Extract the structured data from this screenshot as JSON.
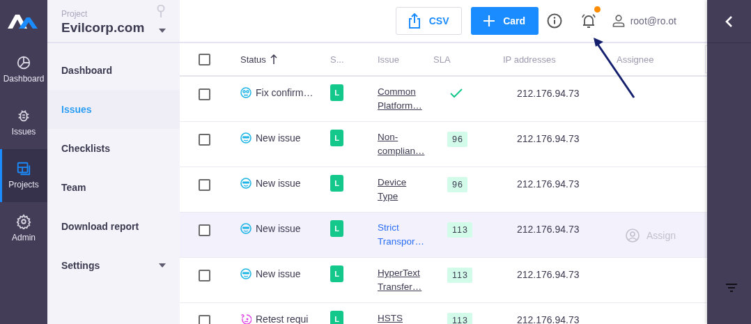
{
  "rail": {
    "items": [
      {
        "label": "Dashboard",
        "selected": false
      },
      {
        "label": "Issues",
        "selected": false
      },
      {
        "label": "Projects",
        "selected": true
      },
      {
        "label": "Admin",
        "selected": false
      }
    ]
  },
  "nav": {
    "project_label": "Project",
    "project_name": "Evilcorp.com",
    "items": [
      {
        "label": "Dashboard",
        "selected": false
      },
      {
        "label": "Issues",
        "selected": true
      },
      {
        "label": "Checklists",
        "selected": false
      },
      {
        "label": "Team",
        "selected": false
      },
      {
        "label": "Download report",
        "selected": false
      },
      {
        "label": "Settings",
        "selected": false,
        "expanded": false
      }
    ]
  },
  "toolbar": {
    "csv_button": "CSV",
    "card_button": "Card",
    "has_notifications": true,
    "user": "root@ro.ot"
  },
  "table": {
    "columns": [
      {
        "label": "Status",
        "sorted": true
      },
      {
        "label": "S...",
        "sorted": false
      },
      {
        "label": "Issue",
        "sorted": false
      },
      {
        "label": "SLA",
        "sorted": false
      },
      {
        "label": "IP addresses",
        "sorted": false
      },
      {
        "label": "Assignee",
        "sorted": false
      }
    ],
    "header_checked": false,
    "rows": [
      {
        "checked": false,
        "hovered": false,
        "status": {
          "kind": "fix_confirmed",
          "label": "Fix confirm…"
        },
        "severity": "L",
        "issue_lines": [
          "Common",
          "Platform…"
        ],
        "sla": {
          "kind": "check"
        },
        "ip": "212.176.94.73"
      },
      {
        "checked": false,
        "hovered": false,
        "status": {
          "kind": "new",
          "label": "New issue"
        },
        "severity": "L",
        "issue_lines": [
          "Non-",
          "complian…"
        ],
        "sla": {
          "kind": "badge",
          "label": "96"
        },
        "ip": "212.176.94.73"
      },
      {
        "checked": false,
        "hovered": false,
        "status": {
          "kind": "new",
          "label": "New issue"
        },
        "severity": "L",
        "issue_lines": [
          "Device",
          "Type"
        ],
        "sla": {
          "kind": "badge",
          "label": "96"
        },
        "ip": "212.176.94.73"
      },
      {
        "checked": false,
        "hovered": true,
        "status": {
          "kind": "new",
          "label": "New issue"
        },
        "severity": "L",
        "issue_lines": [
          "Strict",
          "Transpor…"
        ],
        "sla": {
          "kind": "badge",
          "label": "113"
        },
        "ip": "212.176.94.73",
        "assign": "Assign"
      },
      {
        "checked": false,
        "hovered": false,
        "status": {
          "kind": "new",
          "label": "New issue"
        },
        "severity": "L",
        "issue_lines": [
          "HyperText",
          "Transfer…"
        ],
        "sla": {
          "kind": "badge",
          "label": "113"
        },
        "ip": "212.176.94.73"
      },
      {
        "checked": false,
        "hovered": false,
        "status": {
          "kind": "retest",
          "label": "Retest requi"
        },
        "severity": "L",
        "issue_lines": [
          "HSTS"
        ],
        "sla": {
          "kind": "badge",
          "label": "113"
        },
        "ip": "212.176.94.73"
      }
    ]
  }
}
